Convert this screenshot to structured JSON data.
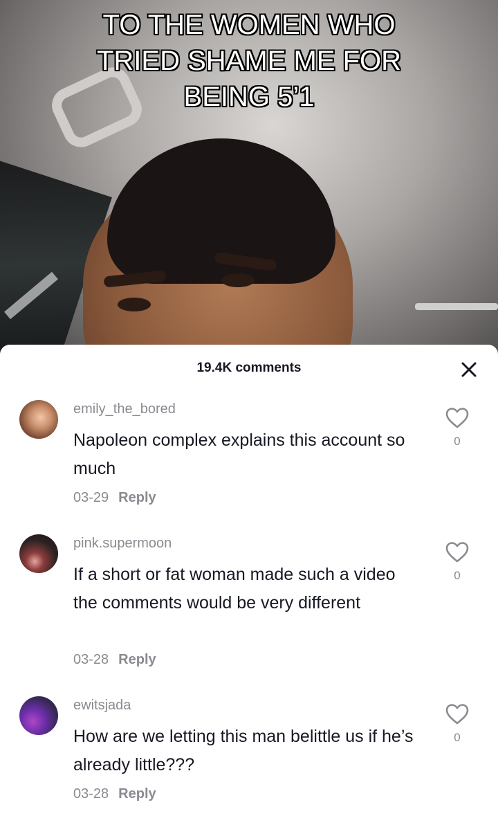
{
  "video": {
    "caption": "TO THE WOMEN WHO\nTRIED SHAME ME FOR\nBEING 5’1"
  },
  "comments_panel": {
    "count_label": "19.4K comments",
    "close_icon": "close-icon"
  },
  "comments": [
    {
      "username": "emily_the_bored",
      "text": "Napoleon complex explains this account so much",
      "date": "03-29",
      "reply_label": "Reply",
      "likes": "0"
    },
    {
      "username": "pink.supermoon",
      "text": "If a short or fat woman made such a video the comments would be very different",
      "date": "03-28",
      "reply_label": "Reply",
      "likes": "0"
    },
    {
      "username": "ewitsjada",
      "text": "How are we letting this man belittle us if he’s already little???",
      "date": "03-28",
      "reply_label": "Reply",
      "likes": "0"
    }
  ],
  "colors": {
    "text_primary": "#161823",
    "text_secondary": "#8a8b91",
    "sheet_background": "#ffffff"
  }
}
